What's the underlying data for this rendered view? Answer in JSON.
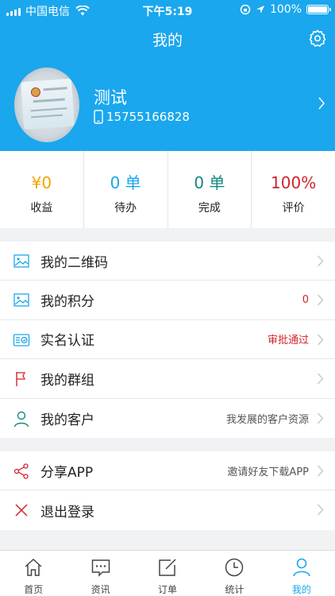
{
  "status_bar": {
    "carrier": "中国电信",
    "time": "下午5:19",
    "battery_percent": "100%"
  },
  "nav": {
    "title": "我的"
  },
  "profile": {
    "name": "测试",
    "phone": "15755166828"
  },
  "stats": [
    {
      "value": "¥0",
      "label": "收益",
      "color": "#f0a500"
    },
    {
      "value": "0 单",
      "label": "待办",
      "color": "#1aa7ee"
    },
    {
      "value": "0 单",
      "label": "完成",
      "color": "#138a7e"
    },
    {
      "value": "100%",
      "label": "评价",
      "color": "#d0242b"
    }
  ],
  "menu_group1": [
    {
      "label": "我的二维码",
      "detail": "",
      "icon": "image-icon"
    },
    {
      "label": "我的积分",
      "detail": "0",
      "icon": "image-icon"
    },
    {
      "label": "实名认证",
      "detail": "审批通过",
      "icon": "id-card-icon"
    },
    {
      "label": "我的群组",
      "detail": "",
      "icon": "flag-icon"
    },
    {
      "label": "我的客户",
      "detail": "我发展的客户资源",
      "icon": "person-icon"
    }
  ],
  "menu_group2": [
    {
      "label": "分享APP",
      "detail": "邀请好友下载APP",
      "icon": "share-icon"
    },
    {
      "label": "退出登录",
      "detail": "",
      "icon": "close-icon"
    }
  ],
  "tabs": [
    {
      "label": "首页",
      "icon": "home-icon"
    },
    {
      "label": "资讯",
      "icon": "message-icon"
    },
    {
      "label": "订单",
      "icon": "edit-icon"
    },
    {
      "label": "统计",
      "icon": "clock-icon"
    },
    {
      "label": "我的",
      "icon": "person-icon",
      "active": true
    }
  ],
  "colors": {
    "brand": "#1aa7ee",
    "alert": "#d0242b"
  }
}
